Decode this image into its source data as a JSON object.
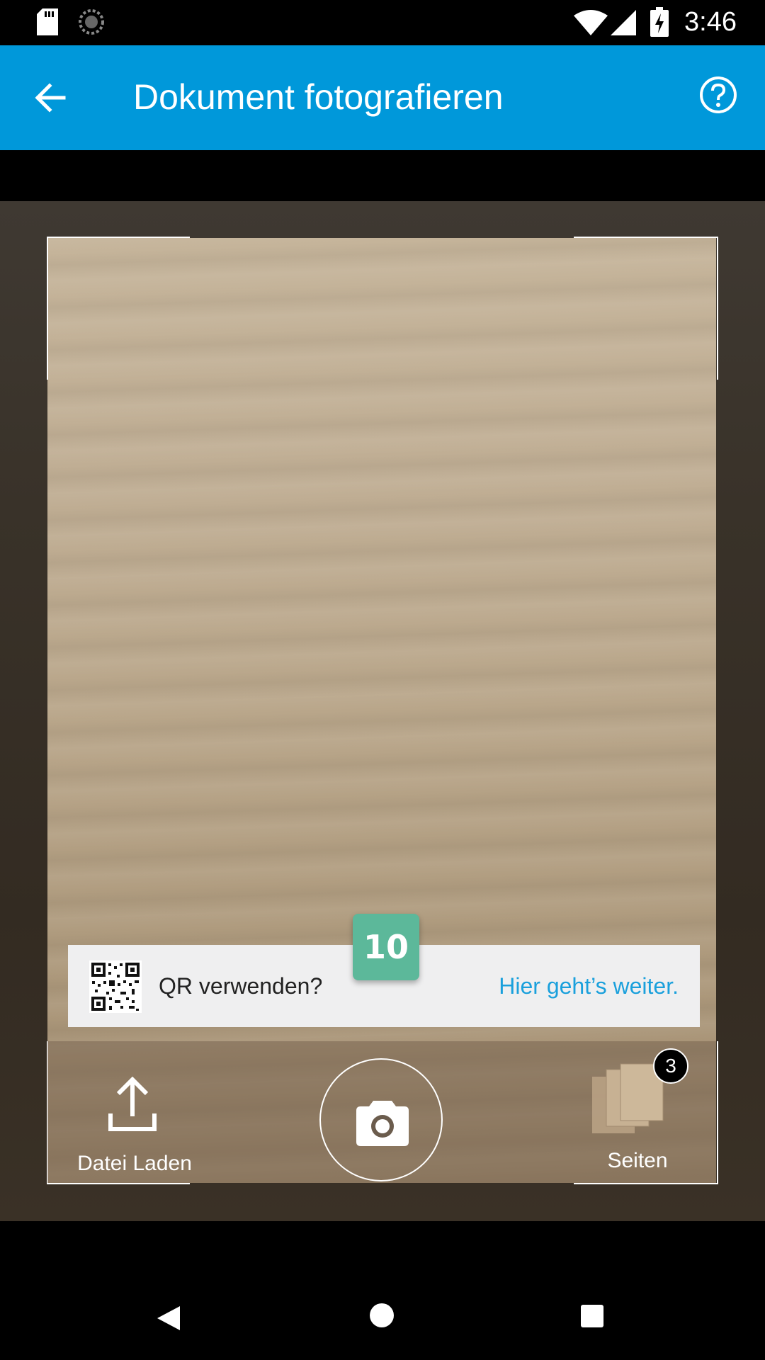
{
  "status_bar": {
    "time": "3:46",
    "icons": [
      "sd-card-icon",
      "sync-icon",
      "wifi-icon",
      "signal-icon",
      "battery-charging-icon"
    ]
  },
  "app_bar": {
    "title": "Dokument fotografieren",
    "back_icon": "arrow-left-icon",
    "help_icon": "help-circle-icon",
    "background": "#0098da"
  },
  "qr_banner": {
    "text": "QR verwenden?",
    "link": "Hier geht’s weiter."
  },
  "counter_badge": {
    "value": "10",
    "color": "#5cb89a"
  },
  "controls": {
    "upload_label": "Datei Laden",
    "pages_label": "Seiten",
    "pages_count": "3"
  }
}
